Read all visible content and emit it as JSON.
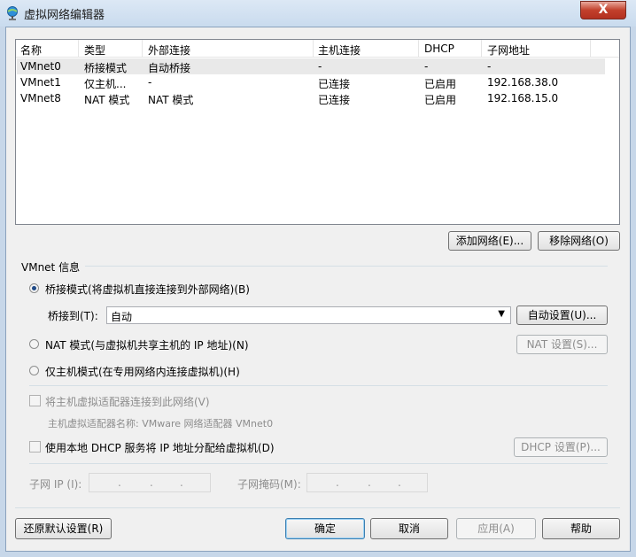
{
  "window": {
    "title": "虚拟网络编辑器",
    "close_label": "X"
  },
  "list": {
    "headers": [
      "名称",
      "类型",
      "外部连接",
      "主机连接",
      "DHCP",
      "子网地址"
    ],
    "rows": [
      [
        "VMnet0",
        "桥接模式",
        "自动桥接",
        "-",
        "-",
        "-"
      ],
      [
        "VMnet1",
        "仅主机...",
        "-",
        "已连接",
        "已启用",
        "192.168.38.0"
      ],
      [
        "VMnet8",
        "NAT 模式",
        "NAT 模式",
        "已连接",
        "已启用",
        "192.168.15.0"
      ]
    ],
    "selected_row": 0
  },
  "list_buttons": {
    "add": "添加网络(E)...",
    "remove": "移除网络(O)"
  },
  "vmnet_info": {
    "group_label": "VMnet 信息",
    "bridged_label": "桥接模式(将虚拟机直接连接到外部网络)(B)",
    "bridge_to_label": "桥接到(T):",
    "bridge_to_value": "自动",
    "auto_settings": "自动设置(U)...",
    "nat_label": "NAT 模式(与虚拟机共享主机的 IP 地址)(N)",
    "nat_settings": "NAT 设置(S)...",
    "hostonly_label": "仅主机模式(在专用网络内连接虚拟机)(H)",
    "connect_host_adapter": "将主机虚拟适配器连接到此网络(V)",
    "host_adapter_name": "主机虚拟适配器名称: VMware 网络适配器 VMnet0",
    "use_dhcp": "使用本地 DHCP 服务将 IP 地址分配给虚拟机(D)",
    "dhcp_settings": "DHCP 设置(P)...",
    "subnet_ip_label": "子网 IP (I):",
    "subnet_mask_label": "子网掩码(M):",
    "selected_mode": "bridged"
  },
  "footer": {
    "restore": "还原默认设置(R)",
    "ok": "确定",
    "cancel": "取消",
    "apply": "应用(A)",
    "help": "帮助"
  },
  "colors": {
    "selected_row": "#e9e9e9",
    "radio_dot": "#204a87",
    "close_red": "#c2402b"
  }
}
